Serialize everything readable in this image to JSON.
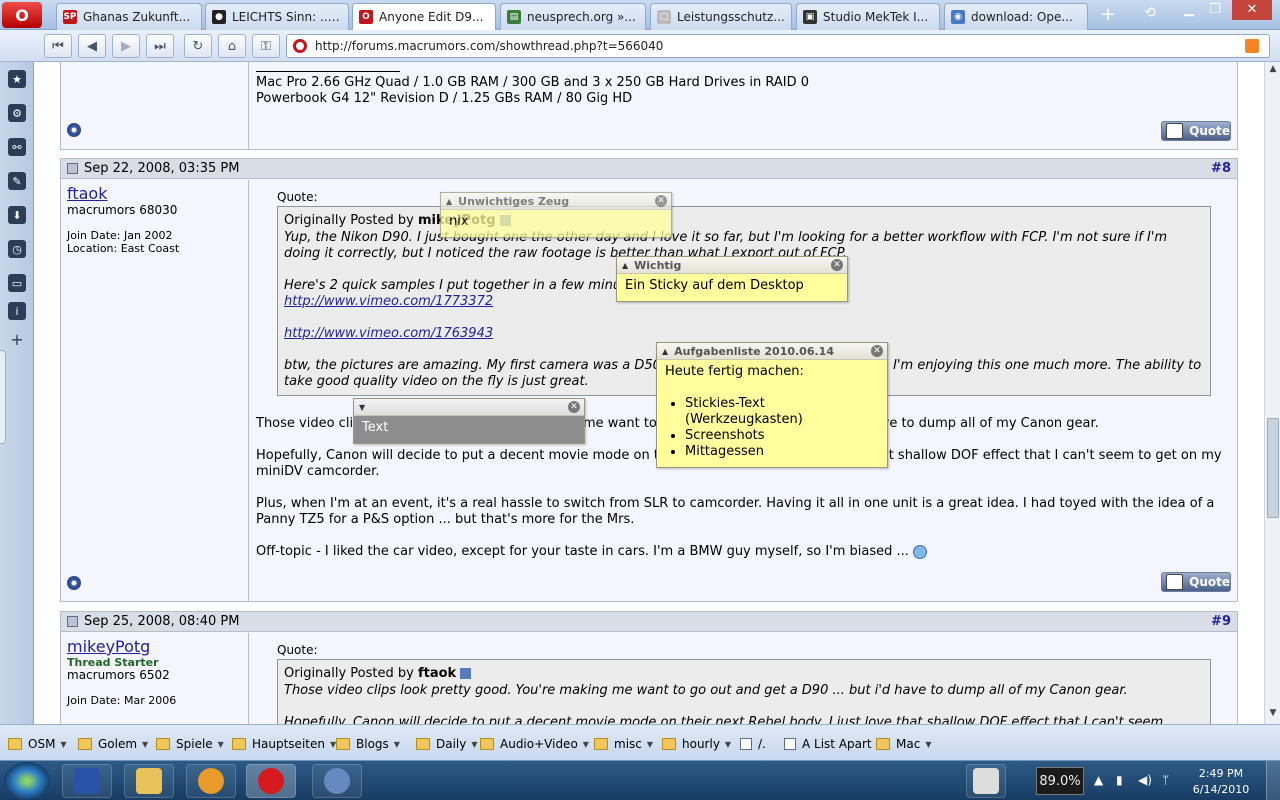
{
  "browser": {
    "tabs": [
      {
        "label": "Ghanas Zukunft...",
        "fav": "SP",
        "favcolor": "#c4161c",
        "active": false
      },
      {
        "label": "LEICHTS Sinn: ......",
        "fav": "●",
        "favcolor": "#222222",
        "active": false
      },
      {
        "label": "Anyone Edit D9...",
        "fav": "O",
        "favcolor": "#c4161c",
        "active": true
      },
      {
        "label": "neusprech.org »...",
        "fav": "▤",
        "favcolor": "#3a7d3a",
        "active": false
      },
      {
        "label": "Leistungsschutz...",
        "fav": "▢",
        "favcolor": "#bbbbbb",
        "active": false
      },
      {
        "label": "Studio MekTek I...",
        "fav": "▣",
        "favcolor": "#333333",
        "active": false
      },
      {
        "label": "download: Ope...",
        "fav": "◉",
        "favcolor": "#4a79c6",
        "active": false
      }
    ],
    "new_tab_label": "+",
    "address_url": "http://forums.macrumors.com/showthread.php?t=566040"
  },
  "forum": {
    "prev_post": {
      "sig_line1": "Mac Pro 2.66 GHz Quad / 1.0 GB RAM / 300 GB and 3 x 250 GB Hard Drives in RAID 0",
      "sig_line2": "Powerbook G4 12\" Revision D / 1.25 GBs RAM / 80 Gig HD",
      "quote_button": "Quote"
    },
    "post8": {
      "date": "Sep 22, 2008, 03:35 PM",
      "number_prefix": "#",
      "number": "8",
      "username": "ftaok",
      "rank": "macrumors 68030",
      "join_date": "Join Date: Jan 2002",
      "location": "Location: East Coast",
      "quote_label": "Quote:",
      "quote_by_prefix": "Originally Posted by ",
      "quote_by_name": "mikeyPotg",
      "quote_p1": "Yup, the Nikon D90. I just bought one the other day and I love it so far, but I'm looking for a better workflow with FCP. I'm not sure if I'm doing it correctly, but I noticed the raw footage is better than what I export out of FCP.",
      "quote_p2": "Here's 2 quick samples I put together in a few minutes.",
      "link1": "http://www.vimeo.com/1773372",
      "link2": "http://www.vimeo.com/1763943",
      "quote_p3": "btw, the pictures are amazing. My first camera was a D50, but I upgraded to a D80 last year. I'm enjoying this one much more. The ability to take good quality video on the fly is just great.",
      "p1": "Those video clips look pretty good. You're making me want to go out and get a D90 ... but i'd have to dump all of my Canon gear.",
      "p2": "Hopefully, Canon will decide to put a decent movie mode on their next Rebel body. I just love that shallow DOF effect that I can't seem to get on my miniDV camcorder.",
      "p3": "Plus, when I'm at an event, it's a real hassle to switch from SLR to camcorder. Having it all in one unit is a great idea. I had toyed with the idea of a Panny TZ5 for a P&S option ... but that's more for the Mrs.",
      "p4": "Off-topic - I liked the car video, except for your taste in cars. I'm a BMW guy myself, so I'm biased ...",
      "quote_button": "Quote"
    },
    "post9": {
      "date": "Sep 25, 2008, 08:40 PM",
      "number_prefix": "#",
      "number": "9",
      "username": "mikeyPotg",
      "starter": "Thread Starter",
      "rank": "macrumors 6502",
      "join_date": "Join Date: Mar 2006",
      "quote_label": "Quote:",
      "quote_by_prefix": "Originally Posted by ",
      "quote_by_name": "ftaok",
      "quote_p1": "Those video clips look pretty good. You're making me want to go out and get a D90 ... but i'd have to dump all of my Canon gear.",
      "quote_p2": "Hopefully, Canon will decide to put a decent movie mode on their next Rebel body. I just love that shallow DOF effect that I can't seem"
    }
  },
  "stickies": {
    "s1": {
      "title": "Unwichtiges Zeug",
      "body": "nix"
    },
    "s2": {
      "title": "Wichtig",
      "body": "Ein Sticky auf dem Desktop"
    },
    "s3": {
      "title": "Aufgabenliste 2010.06.14",
      "heading": "Heute  fertig machen:",
      "items": [
        "Stickies-Text (Werkzeugkasten)",
        "Screenshots",
        "Mittagessen"
      ]
    },
    "s4": {
      "title": "",
      "body": "Text"
    }
  },
  "bookmarks": [
    {
      "label": "OSM",
      "type": "folder"
    },
    {
      "label": "Golem",
      "type": "folder"
    },
    {
      "label": "Spiele",
      "type": "folder"
    },
    {
      "label": "Hauptseiten",
      "type": "folder"
    },
    {
      "label": "Blogs",
      "type": "folder"
    },
    {
      "label": "Daily",
      "type": "folder"
    },
    {
      "label": "Audio+Video",
      "type": "folder"
    },
    {
      "label": "misc",
      "type": "folder"
    },
    {
      "label": "hourly",
      "type": "folder"
    },
    {
      "label": "/.",
      "type": "page"
    },
    {
      "label": "A List Apart",
      "type": "page"
    },
    {
      "label": "Mac",
      "type": "folder"
    }
  ],
  "taskbar": {
    "zoom": "89.0%",
    "time": "2:49 PM",
    "date": "6/14/2010"
  },
  "colors": {
    "link": "#22229c",
    "sticky": "#ffff9e",
    "post_bg": "#f5f5ff"
  }
}
